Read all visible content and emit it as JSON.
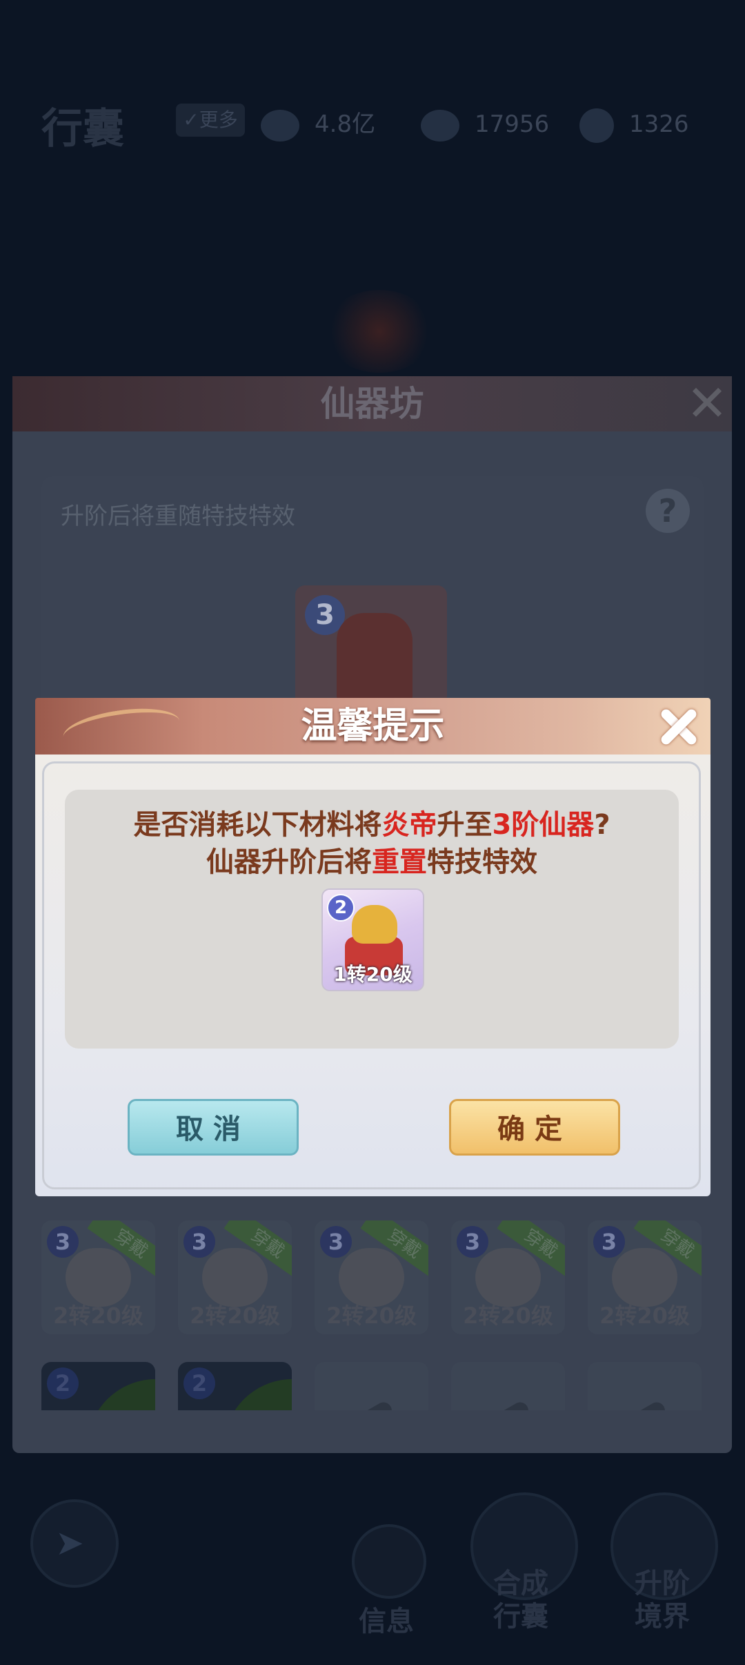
{
  "topbar": {
    "title": "行囊",
    "more_label": "更多",
    "silver": "4.8亿",
    "gold": "17956",
    "jade": "1326"
  },
  "workshop": {
    "title": "仙器坊",
    "hint": "升阶后将重随特技特效",
    "help": "?",
    "big_item_rank": "3",
    "slots_row1": [
      {
        "rank": "3",
        "tag": "穿戴",
        "level": "2转20级"
      },
      {
        "rank": "3",
        "tag": "穿戴",
        "level": "2转20级"
      },
      {
        "rank": "3",
        "tag": "穿戴",
        "level": "2转20级"
      },
      {
        "rank": "3",
        "tag": "穿戴",
        "level": "2转20级"
      },
      {
        "rank": "3",
        "tag": "穿戴",
        "level": "2转20级"
      }
    ],
    "slots_row2": [
      {
        "rank": "2"
      },
      {
        "rank": "2"
      }
    ]
  },
  "bottom_nav": {
    "info": "信息",
    "compose_line1": "合成",
    "compose_line2": "行囊",
    "upgrade_line1": "升阶",
    "upgrade_line2": "境界"
  },
  "dialog": {
    "title": "温馨提示",
    "line1_a": "是否消耗以下材料将",
    "line1_name": "炎帝",
    "line1_b": "升至",
    "line1_rank": "3阶仙器",
    "line1_c": "?",
    "line2_a": "仙器升阶后将",
    "line2_hl": "重置",
    "line2_b": "特技特效",
    "material": {
      "rank": "2",
      "level": "1转20级"
    },
    "cancel": "取消",
    "confirm": "确定"
  }
}
